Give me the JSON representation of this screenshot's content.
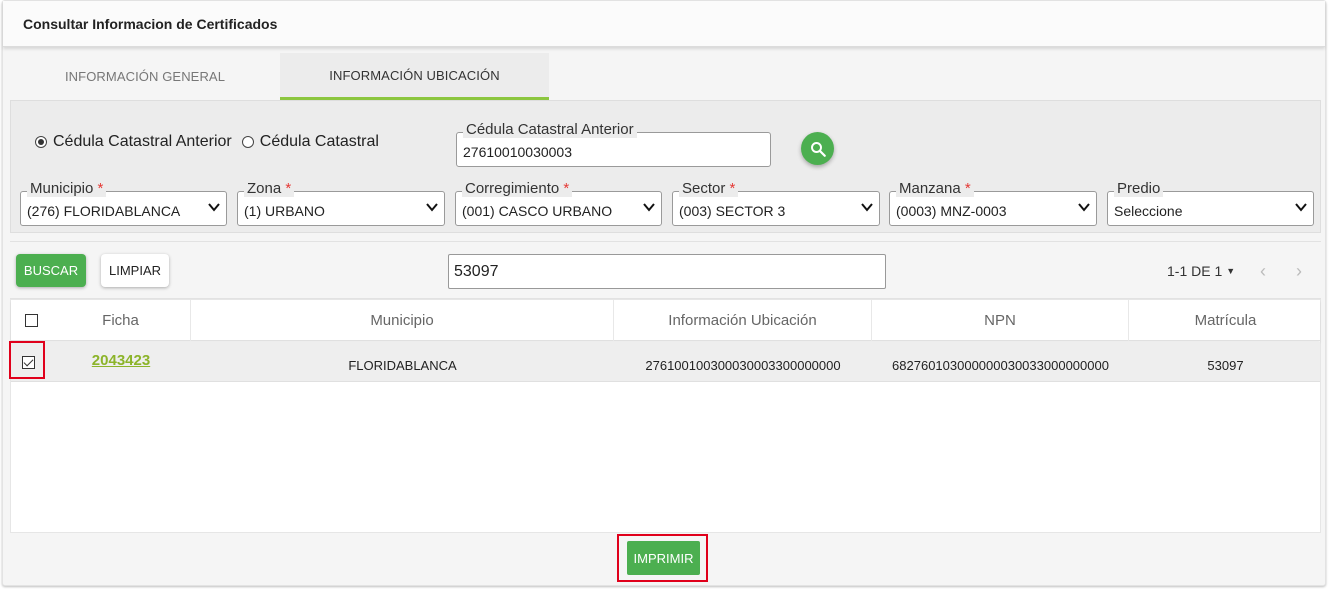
{
  "header": {
    "title": "Consultar Informacion de Certificados"
  },
  "tabs": [
    {
      "label": "INFORMACIÓN GENERAL",
      "active": false
    },
    {
      "label": "INFORMACIÓN UBICACIÓN",
      "active": true
    }
  ],
  "radio": {
    "options": [
      {
        "label": "Cédula Catastral Anterior",
        "selected": true
      },
      {
        "label": "Cédula Catastral",
        "selected": false
      }
    ]
  },
  "cedula": {
    "label": "Cédula Catastral Anterior",
    "value": "27610010030003"
  },
  "selects": {
    "municipio": {
      "label": "Municipio",
      "required": "*",
      "value": "(276) FLORIDABLANCA"
    },
    "zona": {
      "label": "Zona",
      "required": "*",
      "value": "(1) URBANO"
    },
    "corregimiento": {
      "label": "Corregimiento",
      "required": "*",
      "value": "(001) CASCO URBANO"
    },
    "sector": {
      "label": "Sector",
      "required": "*",
      "value": "(003) SECTOR 3"
    },
    "manzana": {
      "label": "Manzana",
      "required": "*",
      "value": "(0003) MNZ-0003"
    },
    "predio": {
      "label": "Predio",
      "value": "Seleccione"
    }
  },
  "actions": {
    "buscar_label": "BUSCAR",
    "limpiar_label": "LIMPIAR",
    "filter_value": "53097",
    "pager_text": "1-1 DE 1",
    "prev": "‹",
    "next": "›"
  },
  "table": {
    "headers": [
      "Ficha",
      "Municipio",
      "Información Ubicación",
      "NPN",
      "Matrícula"
    ],
    "rows": [
      {
        "checked": true,
        "ficha": "2043423",
        "municipio": "FLORIDABLANCA",
        "ubicacion": "276100100300030003300000000",
        "npn": "682760103000000030033000000000",
        "matricula": "53097"
      }
    ]
  },
  "footer": {
    "imprimir_label": "IMPRIMIR"
  },
  "colors": {
    "accent": "#4caf50",
    "link": "#8cb42a",
    "highlight": "#e0001b",
    "required": "#e53935"
  }
}
